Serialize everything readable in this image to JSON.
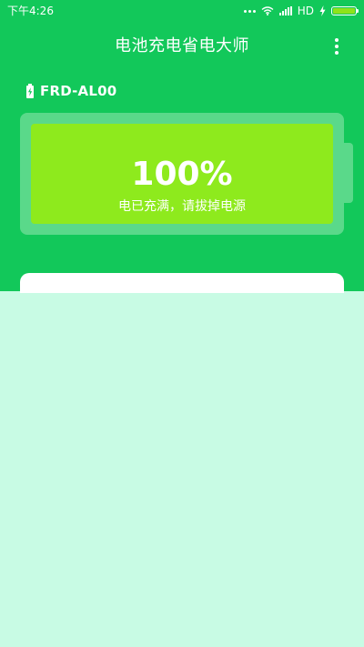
{
  "status_bar": {
    "time": "下午4:26",
    "network": "HD",
    "icons": [
      "dots-icon",
      "wifi-icon",
      "signal-icon",
      "charging-bolt-icon",
      "battery-icon"
    ]
  },
  "header": {
    "title": "电池充电省电大师",
    "menu_icon": "more-vertical-icon"
  },
  "device": {
    "icon": "battery-charging-icon",
    "name": "FRD-AL00"
  },
  "battery": {
    "percent_label": "100%",
    "level": 1.0,
    "message": "电已充满，请拔掉电源"
  },
  "colors": {
    "primary_green": "#12c85a",
    "battery_frame": "#5ad98a",
    "battery_fill": "#8eea1d",
    "background": "#c8fbe4",
    "white": "#ffffff"
  }
}
